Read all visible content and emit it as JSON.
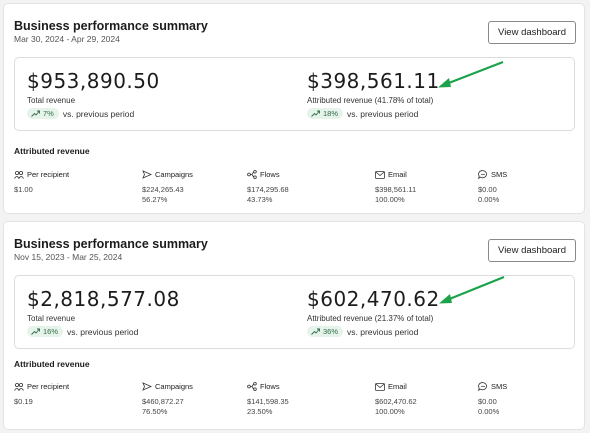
{
  "accent": {
    "arrow_color": "#1aa34a",
    "pill_bg": "#e6f3ea",
    "pill_text": "#2f6b45"
  },
  "cards": [
    {
      "title": "Business performance summary",
      "date_range": "Mar 30, 2024 - Apr 29, 2024",
      "button_label": "View dashboard",
      "total_revenue": {
        "value": "$953,890.50",
        "label": "Total revenue",
        "change": "7%",
        "change_suffix": "vs. previous period"
      },
      "attributed_revenue": {
        "value": "$398,561.11",
        "label": "Attributed revenue (41.78% of total)",
        "change": "18%",
        "change_suffix": "vs. previous period"
      },
      "section_title": "Attributed revenue",
      "columns": [
        {
          "icon": "people-icon",
          "label": "Per recipient",
          "value": "$1.00",
          "percent": ""
        },
        {
          "icon": "send-icon",
          "label": "Campaigns",
          "value": "$224,265.43",
          "percent": "56.27%"
        },
        {
          "icon": "flows-icon",
          "label": "Flows",
          "value": "$174,295.68",
          "percent": "43.73%"
        },
        {
          "icon": "email-icon",
          "label": "Email",
          "value": "$398,561.11",
          "percent": "100.00%"
        },
        {
          "icon": "sms-icon",
          "label": "SMS",
          "value": "$0.00",
          "percent": "0.00%"
        }
      ]
    },
    {
      "title": "Business performance summary",
      "date_range": "Nov 15, 2023 - Mar 25, 2024",
      "button_label": "View dashboard",
      "total_revenue": {
        "value": "$2,818,577.08",
        "label": "Total revenue",
        "change": "16%",
        "change_suffix": "vs. previous period"
      },
      "attributed_revenue": {
        "value": "$602,470.62",
        "label": "Attributed revenue (21.37% of total)",
        "change": "36%",
        "change_suffix": "vs. previous period"
      },
      "section_title": "Attributed revenue",
      "columns": [
        {
          "icon": "people-icon",
          "label": "Per recipient",
          "value": "$0.19",
          "percent": ""
        },
        {
          "icon": "send-icon",
          "label": "Campaigns",
          "value": "$460,872.27",
          "percent": "76.50%"
        },
        {
          "icon": "flows-icon",
          "label": "Flows",
          "value": "$141,598.35",
          "percent": "23.50%"
        },
        {
          "icon": "email-icon",
          "label": "Email",
          "value": "$602,470.62",
          "percent": "100.00%"
        },
        {
          "icon": "sms-icon",
          "label": "SMS",
          "value": "$0.00",
          "percent": "0.00%"
        }
      ]
    }
  ]
}
